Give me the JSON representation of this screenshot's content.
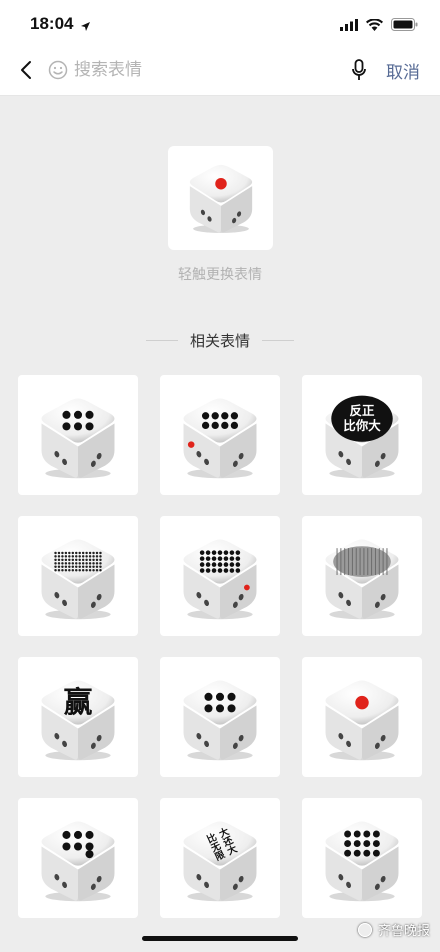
{
  "status": {
    "time": "18:04"
  },
  "search": {
    "placeholder": "搜索表情",
    "value": "",
    "cancel_label": "取消"
  },
  "preview": {
    "face": "one-red",
    "hint": "轻触更换表情"
  },
  "related": {
    "title": "相关表情",
    "items": [
      {
        "face": "six-dots"
      },
      {
        "face": "eight-dots-red"
      },
      {
        "face": "text-black",
        "text": [
          "反正",
          "比你大"
        ]
      },
      {
        "face": "many-dots-fine"
      },
      {
        "face": "many-dots-large"
      },
      {
        "face": "grey-hatch"
      },
      {
        "face": "text-win",
        "text": [
          "赢"
        ]
      },
      {
        "face": "six-dots"
      },
      {
        "face": "one-red"
      },
      {
        "face": "seven-dots"
      },
      {
        "face": "text-vertical",
        "text": [
          "比无限",
          "大还大"
        ]
      },
      {
        "face": "twelve-dots"
      }
    ]
  },
  "watermark": {
    "text": "齐鲁晚报"
  },
  "colors": {
    "accent": "#576b95",
    "red_pip": "#e0231b",
    "background": "#ededed"
  }
}
